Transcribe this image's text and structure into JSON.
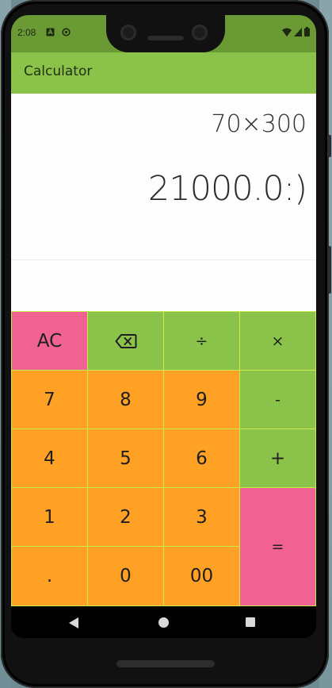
{
  "status_bar": {
    "time": "2:08",
    "left_icons": [
      "a-icon",
      "sync-icon"
    ],
    "right_icons": [
      "wifi-icon",
      "signal-icon",
      "battery-icon"
    ]
  },
  "app_bar": {
    "title": "Calculator"
  },
  "display": {
    "expression": "70×300",
    "result": "21000.0:)"
  },
  "keypad": {
    "keys": [
      {
        "label": "AC",
        "role": "clear",
        "color": "#f06292"
      },
      {
        "label": "⌫",
        "role": "backspace",
        "icon": "backspace-icon",
        "color": "#8bc34a"
      },
      {
        "label": "÷",
        "role": "divide",
        "color": "#8bc34a"
      },
      {
        "label": "×",
        "role": "multiply",
        "color": "#8bc34a"
      },
      {
        "label": "7",
        "role": "digit",
        "color": "#ffa124"
      },
      {
        "label": "8",
        "role": "digit",
        "color": "#ffa124"
      },
      {
        "label": "9",
        "role": "digit",
        "color": "#ffa124"
      },
      {
        "label": "-",
        "role": "subtract",
        "color": "#8bc34a"
      },
      {
        "label": "4",
        "role": "digit",
        "color": "#ffa124"
      },
      {
        "label": "5",
        "role": "digit",
        "color": "#ffa124"
      },
      {
        "label": "6",
        "role": "digit",
        "color": "#ffa124"
      },
      {
        "label": "+",
        "role": "add",
        "color": "#8bc34a"
      },
      {
        "label": "1",
        "role": "digit",
        "color": "#ffa124"
      },
      {
        "label": "2",
        "role": "digit",
        "color": "#ffa124"
      },
      {
        "label": "3",
        "role": "digit",
        "color": "#ffa124"
      },
      {
        "label": "=",
        "role": "equals",
        "color": "#f06292"
      },
      {
        "label": ".",
        "role": "decimal",
        "color": "#ffa124"
      },
      {
        "label": "0",
        "role": "digit",
        "color": "#ffa124"
      },
      {
        "label": "00",
        "role": "double-zero",
        "color": "#ffa124"
      }
    ]
  },
  "colors": {
    "app_bar": "#8bc34a",
    "status_bar": "#6b9a35",
    "number_key": "#ffa124",
    "operator_key": "#8bc34a",
    "action_key": "#f06292"
  },
  "nav_bar": {
    "buttons": [
      "back-icon",
      "home-icon",
      "recents-icon"
    ]
  }
}
